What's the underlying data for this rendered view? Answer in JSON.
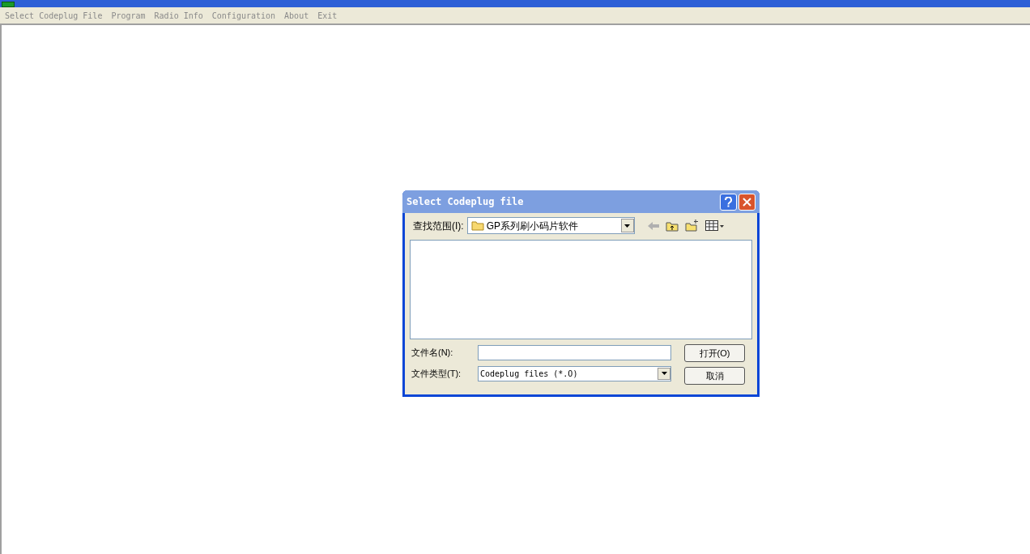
{
  "menu": [
    "Select Codeplug File",
    "Program",
    "Radio Info",
    "Configuration",
    "About",
    "Exit"
  ],
  "dialog": {
    "title": "Select Codeplug file",
    "look_in_label": "查找范围(I):",
    "look_in_value": "GP系列刷小码片软件",
    "file_name_label": "文件名(N):",
    "file_type_label": "文件类型(T):",
    "file_type_value": "Codeplug files (*.O)",
    "buttons": [
      "打开(O)",
      "取消"
    ]
  }
}
